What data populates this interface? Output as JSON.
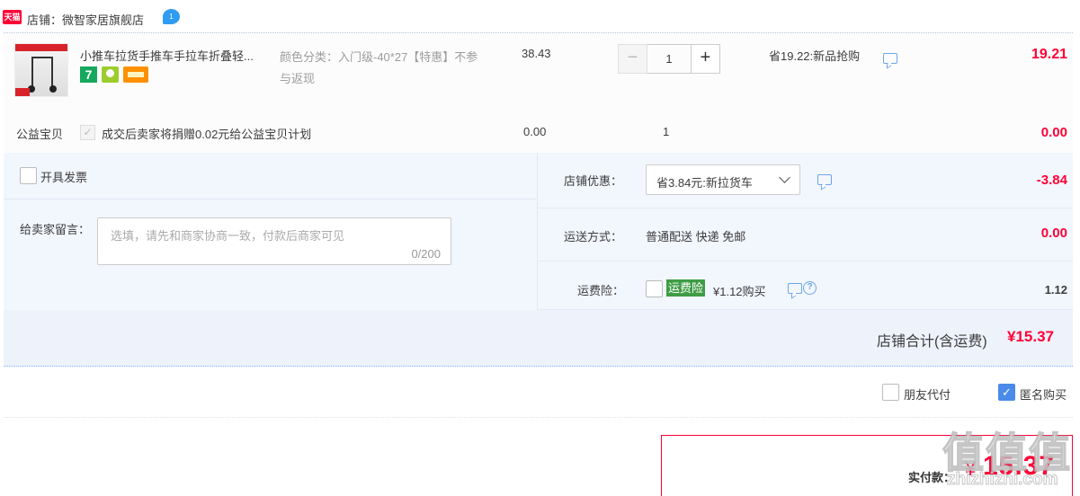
{
  "shop": {
    "logo_text": "天猫",
    "name": "店铺：微智家居旗舰店",
    "chat_badge": "1",
    "chat_icon": "chat-bubble-icon"
  },
  "item": {
    "image_icon": "product-thumbnail",
    "image_band_text": "可推拉货手推车 入门级",
    "image_price_text": "¥80",
    "title": "小推车拉货手推车手拉车折叠轻...",
    "badges": [
      "7",
      "bulb-icon",
      "card-icon"
    ],
    "sku": "颜色分类：入门级-40*27【特惠】不参与返现",
    "price": "38.43",
    "quantity": "1",
    "qty_minus": "−",
    "qty_plus": "+",
    "promo": "省19.22:新品抢购",
    "total": "19.21"
  },
  "charity": {
    "label": "公益宝贝",
    "check_mark": "✓",
    "text": "成交后卖家将捐赠0.02元给公益宝贝计划",
    "price": "0.00",
    "quantity": "1",
    "total": "0.00"
  },
  "invoice": {
    "label": "开具发票",
    "checked": false
  },
  "message": {
    "label": "给卖家留言：",
    "placeholder": "选填，请先和商家协商一致，付款后商家可见",
    "counter": "0/200"
  },
  "store_discount": {
    "label": "店铺优惠：",
    "selected": "省3.84元:新拉货车",
    "amount": "-3.84"
  },
  "shipping": {
    "label": "运送方式：",
    "value": "普通配送 快递 免邮",
    "amount": "0.00"
  },
  "insurance": {
    "label": "运费险：",
    "tag": "运费险",
    "text": "¥1.12购买",
    "help": "?",
    "amount": "1.12",
    "checked": false
  },
  "store_total": {
    "label": "店铺合计(含运费)",
    "amount": "¥15.37"
  },
  "options": {
    "friend_pay": "朋友代付",
    "friend_pay_checked": false,
    "anonymous": "匿名购买",
    "anonymous_checked": true,
    "check_mark": "✓"
  },
  "payment": {
    "label": "实付款：",
    "currency": "¥",
    "amount": "15.37"
  },
  "watermark": {
    "main": "值值值",
    "sub": "zhizhizhi.com"
  },
  "colors": {
    "accent_red": "#ff0036",
    "link_blue": "#4a8ae9",
    "insurance_green": "#3e9c45",
    "tmall_red": "#ff0036"
  }
}
